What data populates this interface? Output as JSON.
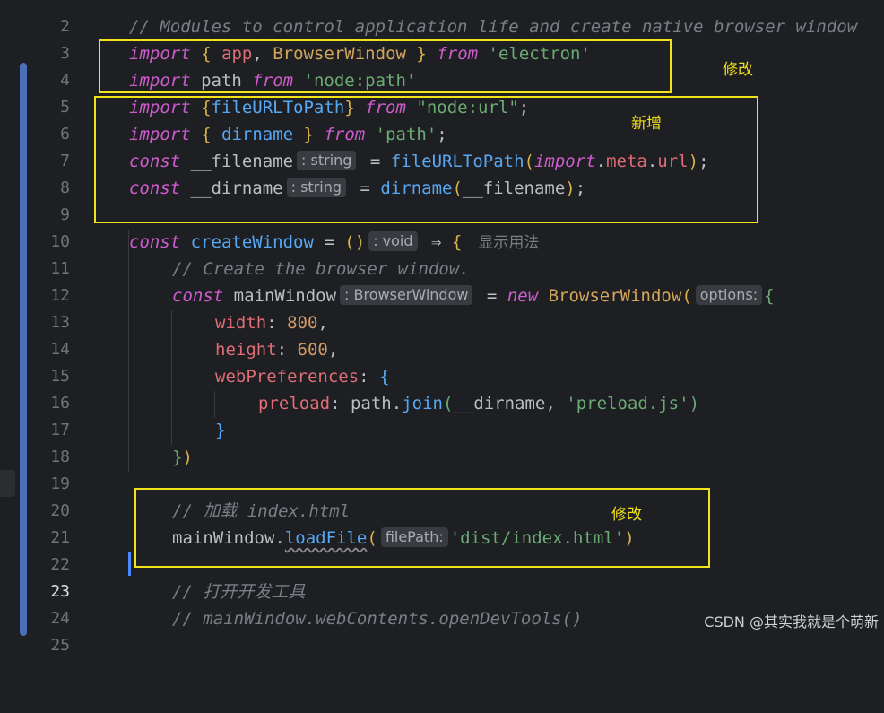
{
  "editor": {
    "current_line": "23",
    "lines": {
      "l2": {
        "num": "2"
      },
      "l3": {
        "num": "3",
        "comment": "// Modules to control application life and create native browser window"
      },
      "l4": {
        "num": "4",
        "import": "import",
        "brace_open": "{",
        "app": "app",
        "comma": ",",
        "browserwindow": "BrowserWindow",
        "brace_close": "}",
        "from": "from",
        "module": "'electron'"
      },
      "l5": {
        "num": "5",
        "import": "import",
        "name": "path",
        "from": "from",
        "module": "'node:path'"
      },
      "l6": {
        "num": "6",
        "import": "import",
        "brace_open": "{",
        "name": "fileURLToPath",
        "brace_close": "}",
        "from": "from",
        "module": "\"node:url\"",
        "semi": ";"
      },
      "l7": {
        "num": "7",
        "import": "import",
        "brace_open": "{",
        "name": "dirname",
        "brace_close": "}",
        "from": "from",
        "module": "'path'",
        "semi": ";"
      },
      "l8": {
        "num": "8",
        "const": "const",
        "name": "__filename",
        "type_hint": ": string",
        "eq": "=",
        "fn": "fileURLToPath",
        "paren_open": "(",
        "import_kw": "import",
        "dot1": ".",
        "meta": "meta",
        "dot2": ".",
        "url": "url",
        "paren_close": ")",
        "semi": ";"
      },
      "l9": {
        "num": "9",
        "const": "const",
        "name": "__dirname",
        "type_hint": ": string",
        "eq": "=",
        "fn": "dirname",
        "paren_open": "(",
        "arg": "__filename",
        "paren_close": ")",
        "semi": ";"
      },
      "l10": {
        "num": "10"
      },
      "l11": {
        "num": "11",
        "const": "const",
        "name": "createWindow",
        "eq": "=",
        "parens": "()",
        "type_hint": ": void",
        "arrow": "⇒",
        "brace": "{",
        "usage_hint": "显示用法"
      },
      "l12": {
        "num": "12",
        "comment": "// Create the browser window."
      },
      "l13": {
        "num": "13",
        "const": "const",
        "name": "mainWindow",
        "type_hint": ": BrowserWindow",
        "eq": "=",
        "new": "new",
        "cls": "BrowserWindow",
        "paren_open": "(",
        "param_hint": "options:",
        "brace": "{"
      },
      "l14": {
        "num": "14",
        "prop": "width",
        "colon": ":",
        "value": "800",
        "comma": ","
      },
      "l15": {
        "num": "15",
        "prop": "height",
        "colon": ":",
        "value": "600",
        "comma": ","
      },
      "l16": {
        "num": "16",
        "prop": "webPreferences",
        "colon": ":",
        "brace": "{"
      },
      "l17": {
        "num": "17",
        "prop": "preload",
        "colon": ":",
        "obj": "path",
        "dot": ".",
        "fn": "join",
        "paren_open": "(",
        "arg1": "__dirname",
        "comma": ",",
        "arg2": "'preload.js'",
        "paren_close": ")"
      },
      "l18": {
        "num": "18",
        "brace": "}"
      },
      "l19": {
        "num": "19",
        "brace": "}",
        "paren": ")"
      },
      "l20": {
        "num": "20"
      },
      "l21": {
        "num": "21",
        "comment": "// 加载 index.html"
      },
      "l22": {
        "num": "22",
        "obj": "mainWindow",
        "dot": ".",
        "fn": "loadFile",
        "paren_open": "(",
        "param_hint": "filePath:",
        "arg": "'dist/index.html'",
        "paren_close": ")"
      },
      "l23": {
        "num": "23"
      },
      "l24": {
        "num": "24",
        "comment": "// 打开开发工具"
      },
      "l25": {
        "num": "25",
        "comment": "// mainWindow.webContents.openDevTools()"
      }
    }
  },
  "annotations": {
    "box1_label": "修改",
    "box2_label": "新增",
    "box3_label": "修改"
  },
  "watermark": "CSDN @其实我就是个萌新",
  "colors": {
    "background": "#1e1f22",
    "keyword": "#cf5ccf",
    "string": "#6aab73",
    "function": "#56a8f5",
    "property": "#e06c75",
    "number": "#d19a66",
    "class": "#d4a65a",
    "comment": "#7a7e85",
    "annotation_box": "#f2e21b",
    "caret": "#4a88ff"
  }
}
